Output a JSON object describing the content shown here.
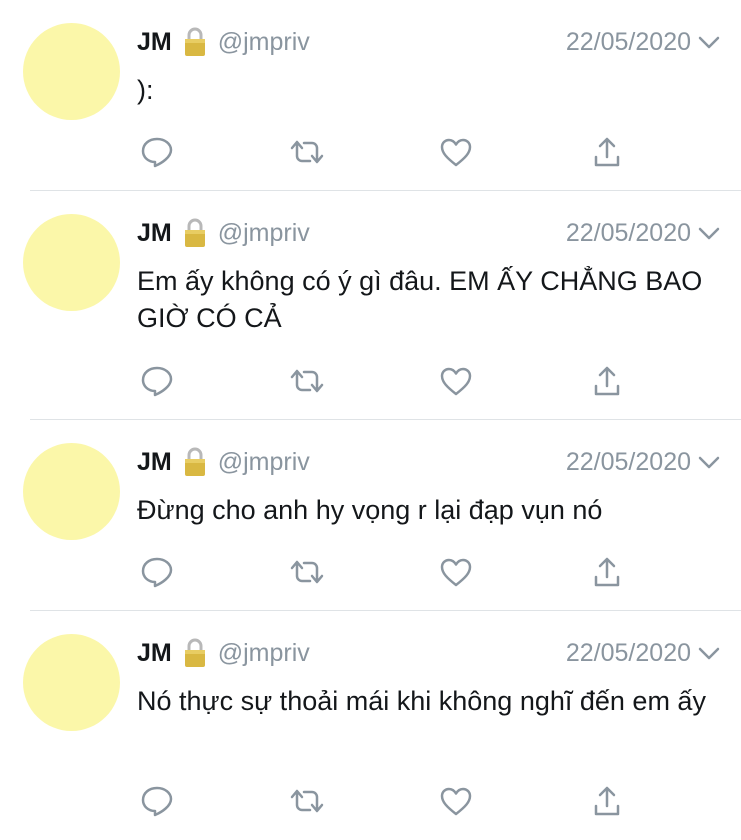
{
  "tweets": [
    {
      "name": "JM",
      "handle": "@jmpriv",
      "date": "22/05/2020",
      "text": "):"
    },
    {
      "name": "JM",
      "handle": "@jmpriv",
      "date": "22/05/2020",
      "text": "Em ấy không có ý gì đâu. EM ẤY CHẲNG BAO GIỜ CÓ CẢ"
    },
    {
      "name": "JM",
      "handle": "@jmpriv",
      "date": "22/05/2020",
      "text": "Đừng cho anh hy vọng r lại đạp vụn nó"
    },
    {
      "name": "JM",
      "handle": "@jmpriv",
      "date": "22/05/2020",
      "text": "Nó thực sự thoải mái khi không nghĩ đến em ấy"
    }
  ],
  "icons": {
    "lock": "lock-icon",
    "chevron": "chevron-down-icon",
    "reply": "reply-icon",
    "retweet": "retweet-icon",
    "like": "heart-icon",
    "share": "share-icon"
  },
  "colors": {
    "avatar": "#fbf7a9",
    "icon": "#8a959f",
    "text": "#14171a",
    "separator": "#dfe3e6"
  }
}
